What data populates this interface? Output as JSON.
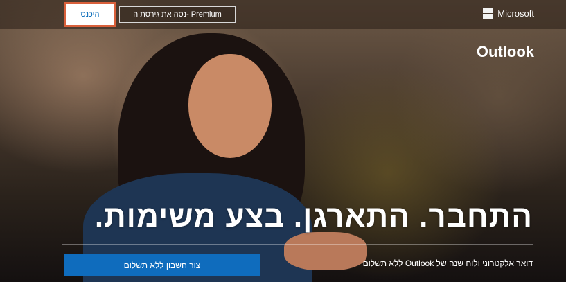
{
  "header": {
    "brand_name": "Microsoft",
    "premium_button": "נסה את גירסת ה- Premium",
    "signin_button": "היכנס"
  },
  "hero": {
    "product_name": "Outlook",
    "headline": "התחבר. התארגן. בצע משימות.",
    "subtext": "דואר אלקטרוני ולוח שנה של Outlook ללא תשלום",
    "create_button": "צור חשבון ללא תשלום"
  },
  "colors": {
    "accent": "#0f6cbd",
    "signin_highlight": "#d9603b"
  },
  "icons": [
    "microsoft-logo-icon"
  ]
}
